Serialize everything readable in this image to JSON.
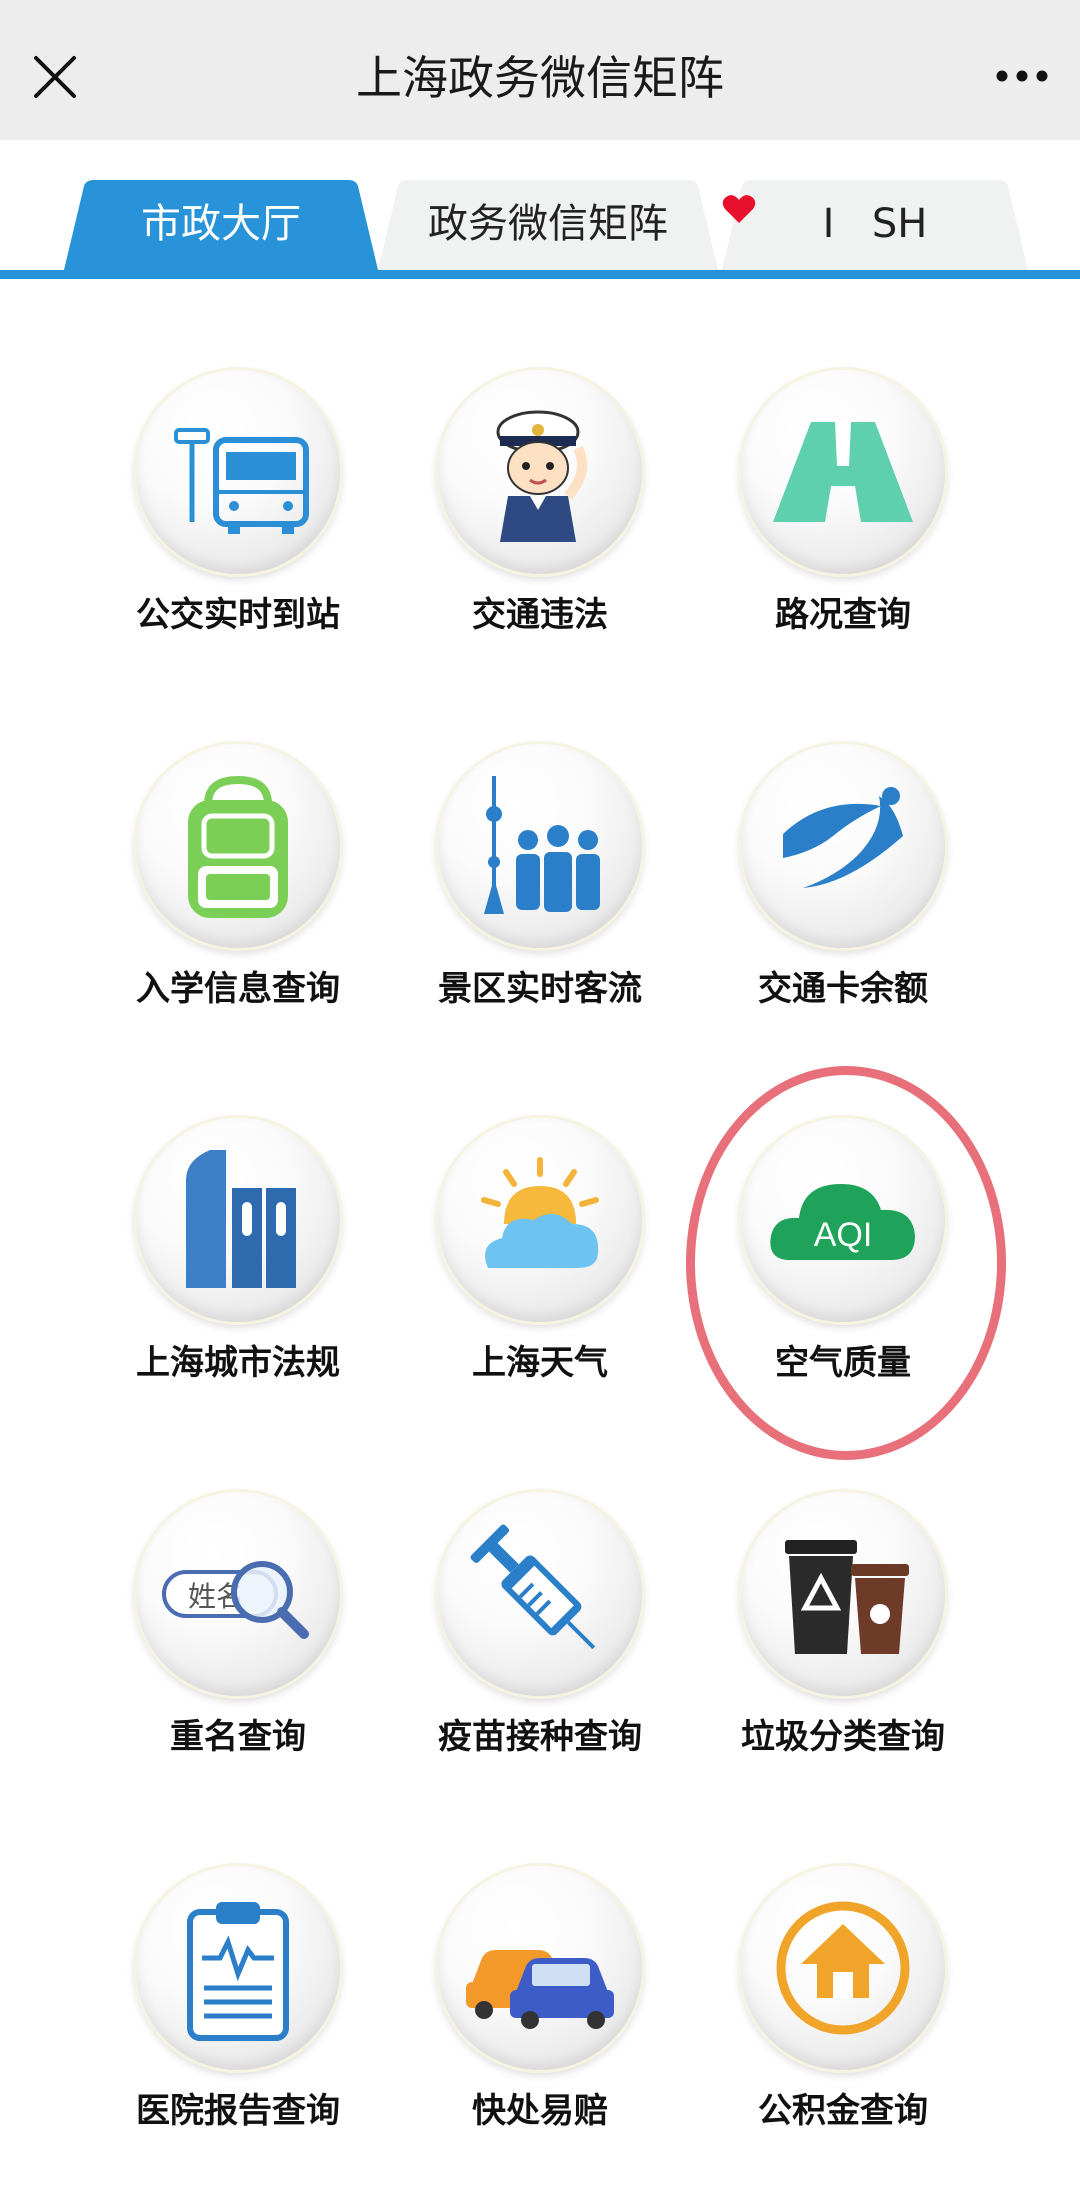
{
  "navbar": {
    "title": "上海政务微信矩阵"
  },
  "tabs": [
    {
      "label": "市政大厅",
      "active": true
    },
    {
      "label": "政务微信矩阵",
      "active": false
    },
    {
      "label_left": "I",
      "label_right": "SH",
      "active": false
    }
  ],
  "services": [
    {
      "label": "公交实时到站",
      "icon": "bus-stop-icon"
    },
    {
      "label": "交通违法",
      "icon": "traffic-police-icon"
    },
    {
      "label": "路况查询",
      "icon": "road-icon"
    },
    {
      "label": "入学信息查询",
      "icon": "school-backpack-icon"
    },
    {
      "label": "景区实时客流",
      "icon": "tourist-crowd-icon"
    },
    {
      "label": "交通卡余额",
      "icon": "transport-card-icon"
    },
    {
      "label": "上海城市法规",
      "icon": "city-regulation-icon"
    },
    {
      "label": "上海天气",
      "icon": "weather-icon"
    },
    {
      "label": "空气质量",
      "icon": "aqi-cloud-icon",
      "icon_text": "AQI",
      "highlighted": true
    },
    {
      "label": "重名查询",
      "icon": "name-search-icon",
      "icon_text": "姓名"
    },
    {
      "label": "疫苗接种查询",
      "icon": "syringe-icon"
    },
    {
      "label": "垃圾分类查询",
      "icon": "trash-bins-icon"
    },
    {
      "label": "医院报告查询",
      "icon": "clipboard-report-icon"
    },
    {
      "label": "快处易赔",
      "icon": "cars-accident-icon"
    },
    {
      "label": "公积金查询",
      "icon": "housing-fund-icon"
    }
  ],
  "colors": {
    "accent": "#2893d8",
    "highlight_ring": "#e8707a",
    "aqi_green": "#1fa35a",
    "heart_red": "#e8112d"
  }
}
